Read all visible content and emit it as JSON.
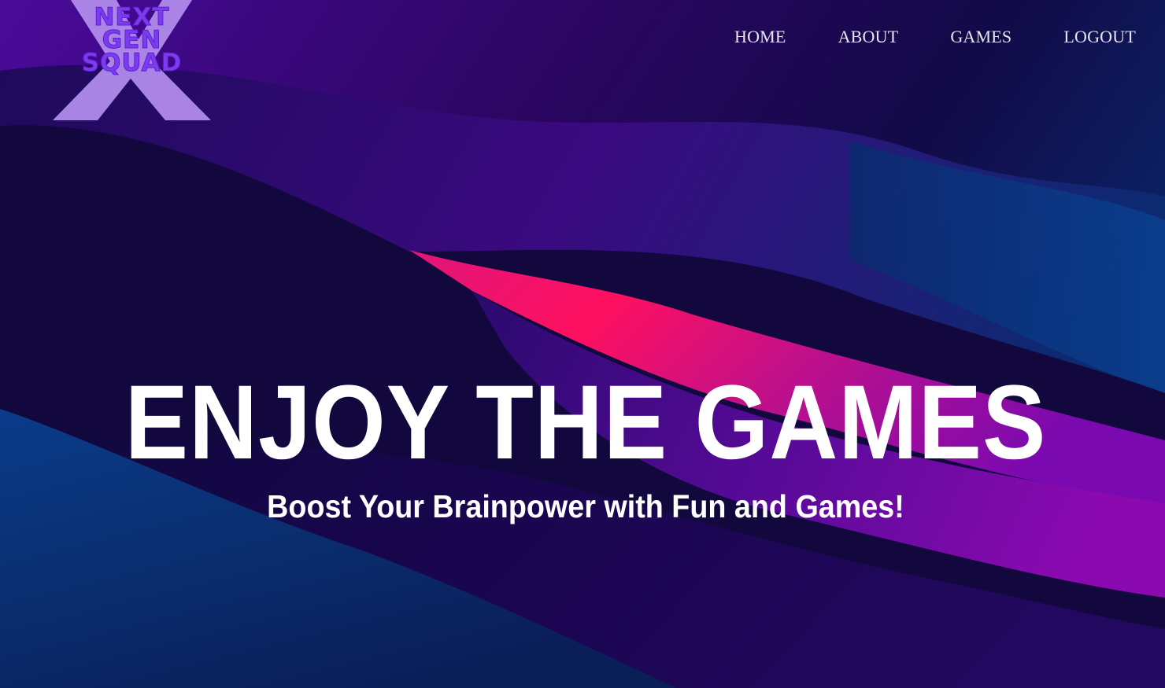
{
  "logo": {
    "lines": [
      "NEXT",
      "GEN",
      "SQUAD"
    ]
  },
  "nav": {
    "items": [
      {
        "label": "HOME"
      },
      {
        "label": "ABOUT"
      },
      {
        "label": "GAMES"
      },
      {
        "label": "LOGOUT"
      }
    ]
  },
  "hero": {
    "title": "ENJOY THE GAMES",
    "subtitle": "Boost Your Brainpower with Fun and Games!"
  },
  "colors": {
    "background_dark": "#1a0a4a",
    "wave_pink": "#ff1a6e",
    "wave_purple": "#7a0aa6",
    "wave_blue": "#0a2e6e",
    "logo_x": "#b48ff0",
    "logo_text": "#7b3cf0",
    "nav_text": "#e6e6f2",
    "hero_text": "#ffffff"
  }
}
